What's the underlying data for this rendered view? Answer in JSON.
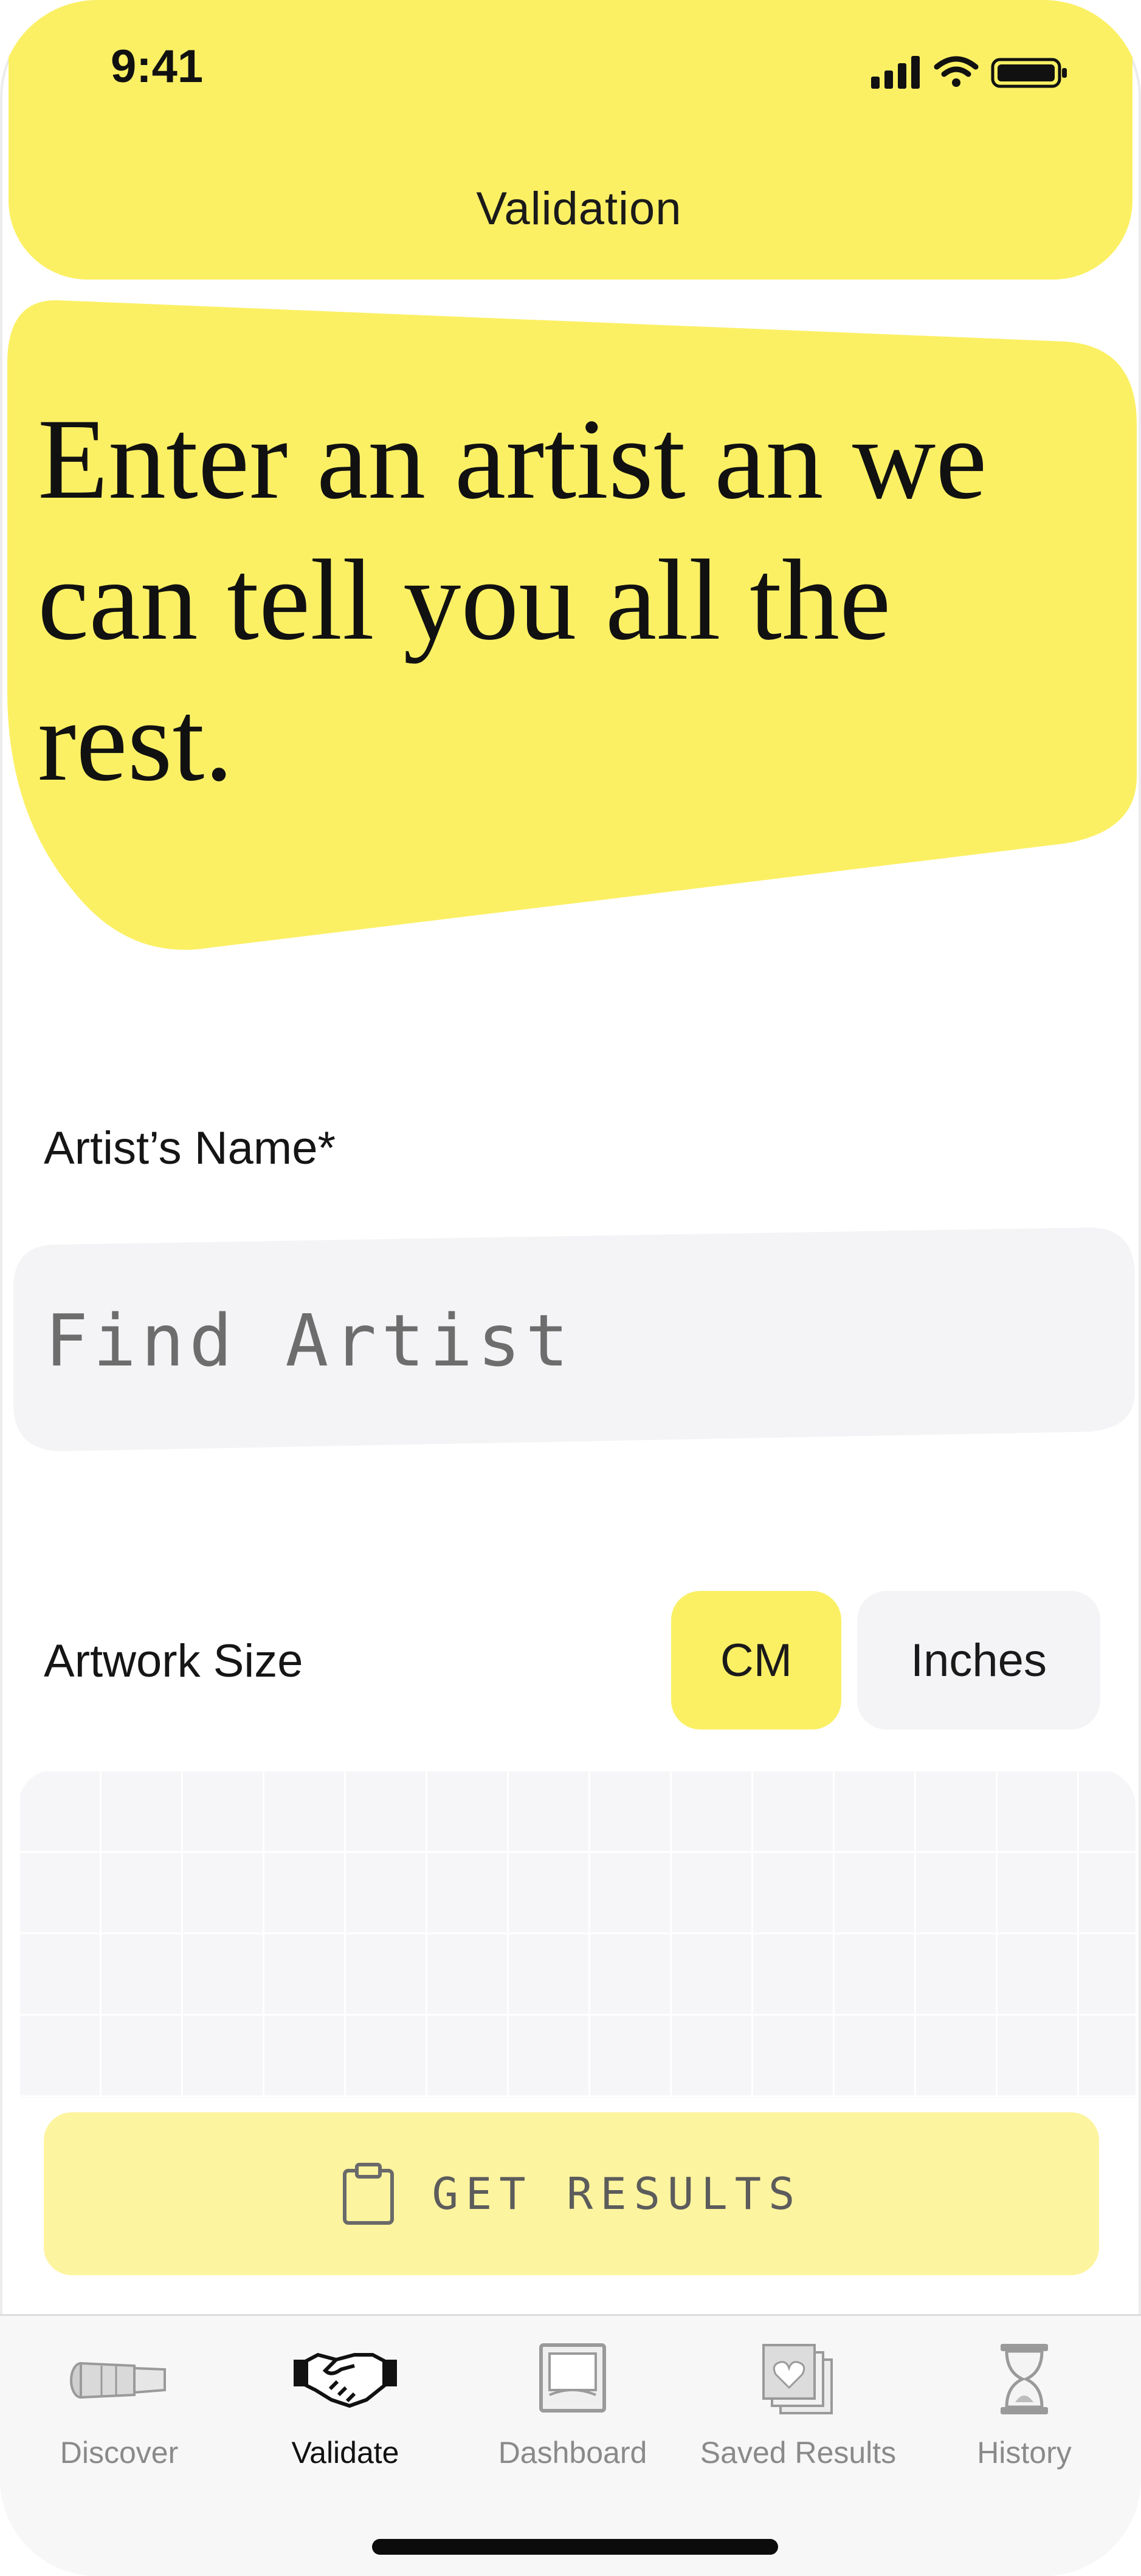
{
  "status_bar": {
    "time": "9:41"
  },
  "header": {
    "title": "Validation"
  },
  "hero": {
    "text": "Enter an artist an we can tell you all the rest."
  },
  "form": {
    "artist_label": "Artist’s Name*",
    "artist_placeholder": "Find Artist",
    "size_label": "Artwork Size",
    "units": [
      "CM",
      "Inches"
    ],
    "selected_unit": "CM",
    "submit_label": "GET RESULTS"
  },
  "tabbar": {
    "items": [
      {
        "label": "Discover",
        "icon": "telescope-icon"
      },
      {
        "label": "Validate",
        "icon": "handshake-icon"
      },
      {
        "label": "Dashboard",
        "icon": "dashboard-frame-icon"
      },
      {
        "label": "Saved Results",
        "icon": "saved-stack-icon"
      },
      {
        "label": "History",
        "icon": "hourglass-icon"
      }
    ],
    "active": "Validate"
  },
  "colors": {
    "accent_yellow": "#fbf064",
    "light_yellow": "#fdf49f",
    "input_bg": "#f4f4f6"
  }
}
